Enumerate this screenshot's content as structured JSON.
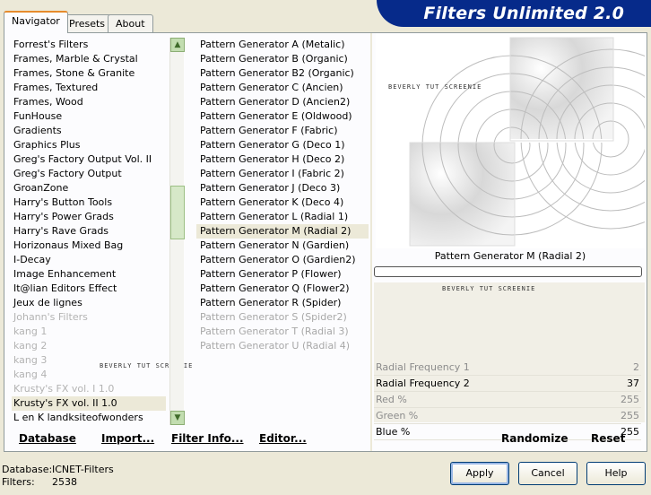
{
  "tabs": [
    "Navigator",
    "Presets",
    "About"
  ],
  "app_title": "Filters Unlimited 2.0",
  "categories": [
    {
      "label": "Forrest's Filters"
    },
    {
      "label": "Frames, Marble & Crystal"
    },
    {
      "label": "Frames, Stone & Granite"
    },
    {
      "label": "Frames, Textured"
    },
    {
      "label": "Frames, Wood"
    },
    {
      "label": "FunHouse"
    },
    {
      "label": "Gradients"
    },
    {
      "label": "Graphics Plus"
    },
    {
      "label": "Greg's Factory Output Vol. II"
    },
    {
      "label": "Greg's Factory Output"
    },
    {
      "label": "GroanZone"
    },
    {
      "label": "Harry's Button Tools"
    },
    {
      "label": "Harry's Power Grads"
    },
    {
      "label": "Harry's Rave Grads"
    },
    {
      "label": "Horizonaus Mixed Bag"
    },
    {
      "label": "I-Decay"
    },
    {
      "label": "Image Enhancement"
    },
    {
      "label": "It@lian Editors Effect"
    },
    {
      "label": "Jeux de lignes"
    },
    {
      "label": "Johann's Filters"
    },
    {
      "label": "kang 1"
    },
    {
      "label": "kang 2"
    },
    {
      "label": "kang 3"
    },
    {
      "label": "kang 4"
    },
    {
      "label": "Krusty's FX vol. I 1.0"
    },
    {
      "label": "Krusty's FX vol. II 1.0"
    },
    {
      "label": "L en K landksiteofwonders"
    }
  ],
  "filters": [
    "Pattern Generator A (Metalic)",
    "Pattern Generator B (Organic)",
    "Pattern Generator B2 (Organic)",
    "Pattern Generator C (Ancien)",
    "Pattern Generator D (Ancien2)",
    "Pattern Generator E (Oldwood)",
    "Pattern Generator F (Fabric)",
    "Pattern Generator G (Deco 1)",
    "Pattern Generator H (Deco 2)",
    "Pattern Generator I (Fabric 2)",
    "Pattern Generator J (Deco 3)",
    "Pattern Generator K (Deco 4)",
    "Pattern Generator L (Radial 1)",
    "Pattern Generator M (Radial 2)",
    "Pattern Generator N (Gardien)",
    "Pattern Generator O (Gardien2)",
    "Pattern Generator P (Flower)",
    "Pattern Generator Q (Flower2)",
    "Pattern Generator R (Spider)",
    "Pattern Generator S (Spider2)",
    "Pattern Generator T (Radial 3)",
    "Pattern Generator U (Radial 4)"
  ],
  "watermark": "BEVERLY TUT SCREENIE",
  "selected_filter": "Pattern Generator M (Radial 2)",
  "progress": 0,
  "params": [
    {
      "label": "Radial Frequency 1",
      "value": "2"
    },
    {
      "label": "Radial Frequency 2",
      "value": "37"
    },
    {
      "label": "Red %",
      "value": "255"
    },
    {
      "label": "Green %",
      "value": "255"
    },
    {
      "label": "Blue %",
      "value": "255"
    }
  ],
  "bottom_links": {
    "database": "Database",
    "import": "Import...",
    "filter_info": "Filter Info...",
    "editor": "Editor...",
    "randomize": "Randomize",
    "reset": "Reset"
  },
  "status": {
    "database_label": "Database:",
    "database_value": "ICNET-Filters",
    "filters_label": "Filters:",
    "filters_value": "2538"
  },
  "buttons": {
    "apply": "Apply",
    "cancel": "Cancel",
    "help": "Help"
  },
  "icons": {
    "scroll_up": "scroll-up-arrow-icon",
    "scroll_down": "scroll-down-arrow-icon"
  },
  "colors": {
    "banner": "#062a8a",
    "active_tab": "#e68b2c",
    "scroll": "#c2ddb0"
  }
}
